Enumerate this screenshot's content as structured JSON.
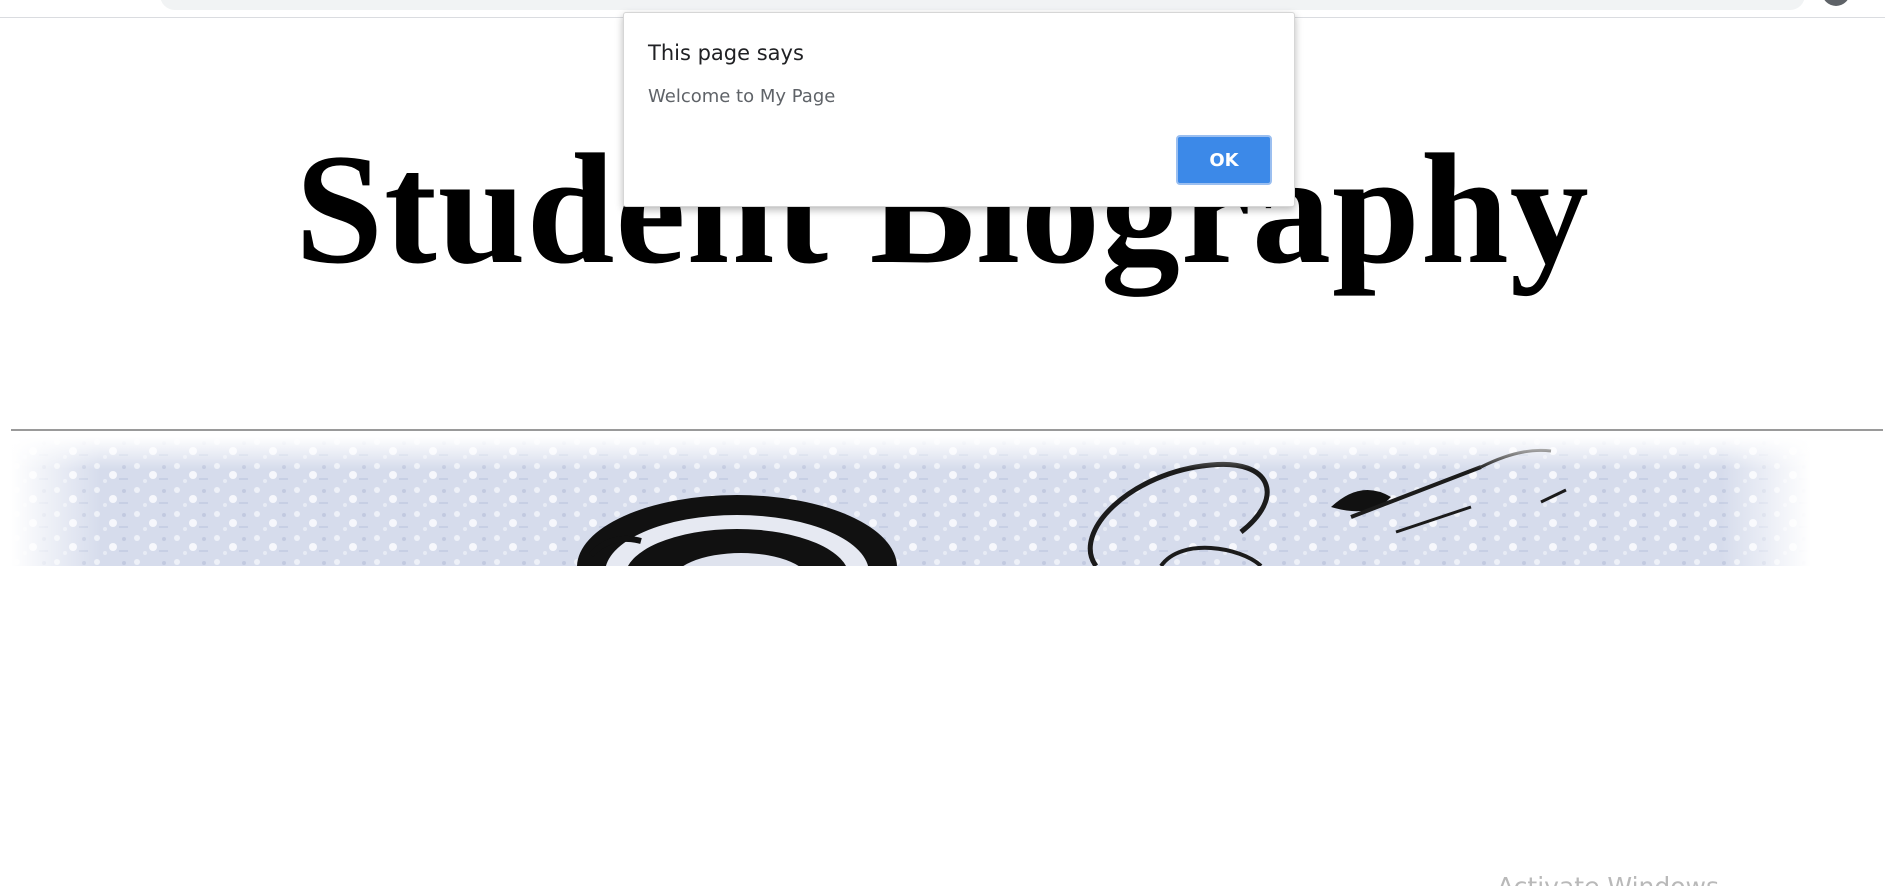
{
  "page": {
    "title": "Student Biography",
    "watermark": "Activate Windows"
  },
  "alert": {
    "heading": "This page says",
    "message": "Welcome to My Page",
    "ok_label": "OK"
  },
  "colors": {
    "ok_button": "#3c89e8",
    "divider": "#9a9a9a",
    "banner_tint": "#c9d1e6"
  },
  "icons": {
    "banner": "abstract-ink-splash-banner",
    "profile": "profile-avatar"
  }
}
